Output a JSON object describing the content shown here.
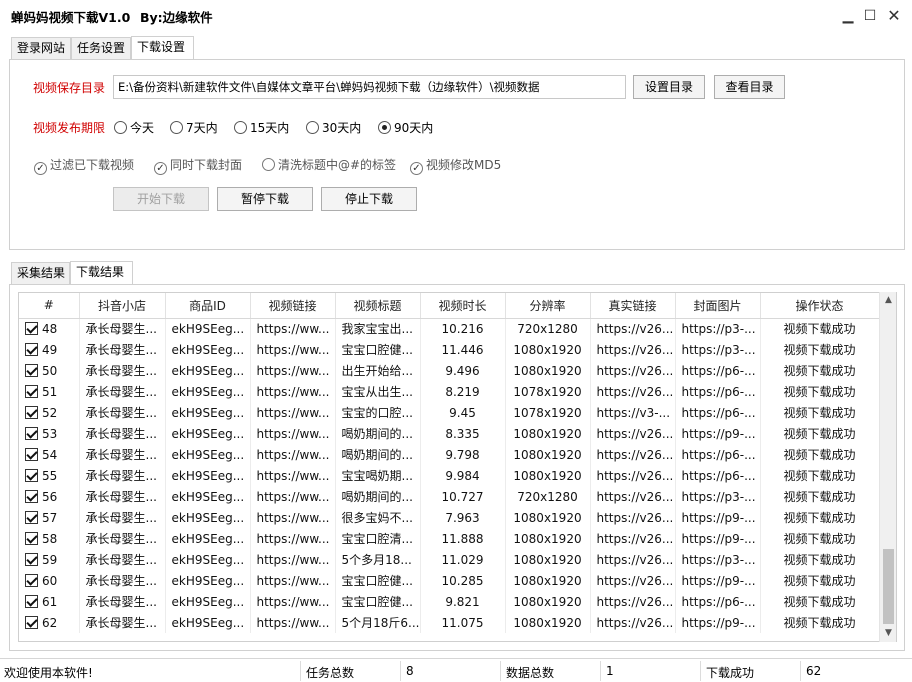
{
  "window": {
    "title": "蝉妈妈视频下载V1.0",
    "author": "By:边缘软件",
    "minimize_glyph": "▁",
    "maximize_glyph": "☐",
    "close_glyph": "✕"
  },
  "top_tabs": [
    {
      "label": "登录网站",
      "active": false
    },
    {
      "label": "任务设置",
      "active": false
    },
    {
      "label": "下载设置",
      "active": true
    }
  ],
  "settings": {
    "save_dir_label": "视频保存目录",
    "save_dir_value": "E:\\备份资料\\新建软件文件\\自媒体文章平台\\蝉妈妈视频下载（边缘软件）\\视频数据",
    "set_dir_button": "设置目录",
    "view_dir_button": "查看目录",
    "period_label": "视频发布期限",
    "period_options": [
      {
        "label": "今天",
        "selected": false
      },
      {
        "label": "7天内",
        "selected": false
      },
      {
        "label": "15天内",
        "selected": false
      },
      {
        "label": "30天内",
        "selected": false
      },
      {
        "label": "90天内",
        "selected": true
      }
    ],
    "options": [
      {
        "label": "过滤已下载视频",
        "checked": true
      },
      {
        "label": "同时下载封面",
        "checked": true
      },
      {
        "label": "清洗标题中@#的标签",
        "checked": false
      },
      {
        "label": "视频修改MD5",
        "checked": true
      }
    ],
    "start_button": "开始下载",
    "pause_button": "暂停下载",
    "stop_button": "停止下载"
  },
  "bottom_tabs": [
    {
      "label": "采集结果",
      "active": false
    },
    {
      "label": "下载结果",
      "active": true
    }
  ],
  "table": {
    "columns": [
      "#",
      "抖音小店",
      "商品ID",
      "视频链接",
      "视频标题",
      "视频时长",
      "分辨率",
      "真实链接",
      "封面图片",
      "操作状态"
    ],
    "rows": [
      {
        "no": "48",
        "shop": "承长母婴生...",
        "pid": "ekH9SEeg...",
        "link": "https://ww...",
        "title": "我家宝宝出...",
        "duration": "10.216",
        "res": "720x1280",
        "real": "https://v26...",
        "cover": "https://p3-...",
        "status": "视频下载成功"
      },
      {
        "no": "49",
        "shop": "承长母婴生...",
        "pid": "ekH9SEeg...",
        "link": "https://ww...",
        "title": "宝宝口腔健...",
        "duration": "11.446",
        "res": "1080x1920",
        "real": "https://v26...",
        "cover": "https://p3-...",
        "status": "视频下载成功"
      },
      {
        "no": "50",
        "shop": "承长母婴生...",
        "pid": "ekH9SEeg...",
        "link": "https://ww...",
        "title": "出生开始给...",
        "duration": "9.496",
        "res": "1080x1920",
        "real": "https://v26...",
        "cover": "https://p6-...",
        "status": "视频下载成功"
      },
      {
        "no": "51",
        "shop": "承长母婴生...",
        "pid": "ekH9SEeg...",
        "link": "https://ww...",
        "title": "宝宝从出生...",
        "duration": "8.219",
        "res": "1078x1920",
        "real": "https://v26...",
        "cover": "https://p6-...",
        "status": "视频下载成功"
      },
      {
        "no": "52",
        "shop": "承长母婴生...",
        "pid": "ekH9SEeg...",
        "link": "https://ww...",
        "title": "宝宝的口腔...",
        "duration": "9.45",
        "res": "1078x1920",
        "real": "https://v3-...",
        "cover": "https://p6-...",
        "status": "视频下载成功"
      },
      {
        "no": "53",
        "shop": "承长母婴生...",
        "pid": "ekH9SEeg...",
        "link": "https://ww...",
        "title": "喝奶期间的...",
        "duration": "8.335",
        "res": "1080x1920",
        "real": "https://v26...",
        "cover": "https://p9-...",
        "status": "视频下载成功"
      },
      {
        "no": "54",
        "shop": "承长母婴生...",
        "pid": "ekH9SEeg...",
        "link": "https://ww...",
        "title": "喝奶期间的...",
        "duration": "9.798",
        "res": "1080x1920",
        "real": "https://v26...",
        "cover": "https://p6-...",
        "status": "视频下载成功"
      },
      {
        "no": "55",
        "shop": "承长母婴生...",
        "pid": "ekH9SEeg...",
        "link": "https://ww...",
        "title": "宝宝喝奶期...",
        "duration": "9.984",
        "res": "1080x1920",
        "real": "https://v26...",
        "cover": "https://p6-...",
        "status": "视频下载成功"
      },
      {
        "no": "56",
        "shop": "承长母婴生...",
        "pid": "ekH9SEeg...",
        "link": "https://ww...",
        "title": "喝奶期间的...",
        "duration": "10.727",
        "res": "720x1280",
        "real": "https://v26...",
        "cover": "https://p3-...",
        "status": "视频下载成功"
      },
      {
        "no": "57",
        "shop": "承长母婴生...",
        "pid": "ekH9SEeg...",
        "link": "https://ww...",
        "title": "很多宝妈不...",
        "duration": "7.963",
        "res": "1080x1920",
        "real": "https://v26...",
        "cover": "https://p9-...",
        "status": "视频下载成功"
      },
      {
        "no": "58",
        "shop": "承长母婴生...",
        "pid": "ekH9SEeg...",
        "link": "https://ww...",
        "title": "宝宝口腔清...",
        "duration": "11.888",
        "res": "1080x1920",
        "real": "https://v26...",
        "cover": "https://p9-...",
        "status": "视频下载成功"
      },
      {
        "no": "59",
        "shop": "承长母婴生...",
        "pid": "ekH9SEeg...",
        "link": "https://ww...",
        "title": "5个多月18...",
        "duration": "11.029",
        "res": "1080x1920",
        "real": "https://v26...",
        "cover": "https://p3-...",
        "status": "视频下载成功"
      },
      {
        "no": "60",
        "shop": "承长母婴生...",
        "pid": "ekH9SEeg...",
        "link": "https://ww...",
        "title": "宝宝口腔健...",
        "duration": "10.285",
        "res": "1080x1920",
        "real": "https://v26...",
        "cover": "https://p9-...",
        "status": "视频下载成功"
      },
      {
        "no": "61",
        "shop": "承长母婴生...",
        "pid": "ekH9SEeg...",
        "link": "https://ww...",
        "title": "宝宝口腔健...",
        "duration": "9.821",
        "res": "1080x1920",
        "real": "https://v26...",
        "cover": "https://p6-...",
        "status": "视频下载成功"
      },
      {
        "no": "62",
        "shop": "承长母婴生...",
        "pid": "ekH9SEeg...",
        "link": "https://ww...",
        "title": "5个月18斤6...",
        "duration": "11.075",
        "res": "1080x1920",
        "real": "https://v26...",
        "cover": "https://p9-...",
        "status": "视频下载成功"
      }
    ]
  },
  "statusbar": {
    "welcome": "欢迎使用本软件!",
    "task_total_label": "任务总数",
    "task_total_value": "8",
    "data_total_label": "数据总数",
    "data_total_value": "1",
    "success_label": "下载成功",
    "success_value": "62"
  },
  "colors": {
    "label_red": "#d00000",
    "border": "#d0d0d0"
  }
}
